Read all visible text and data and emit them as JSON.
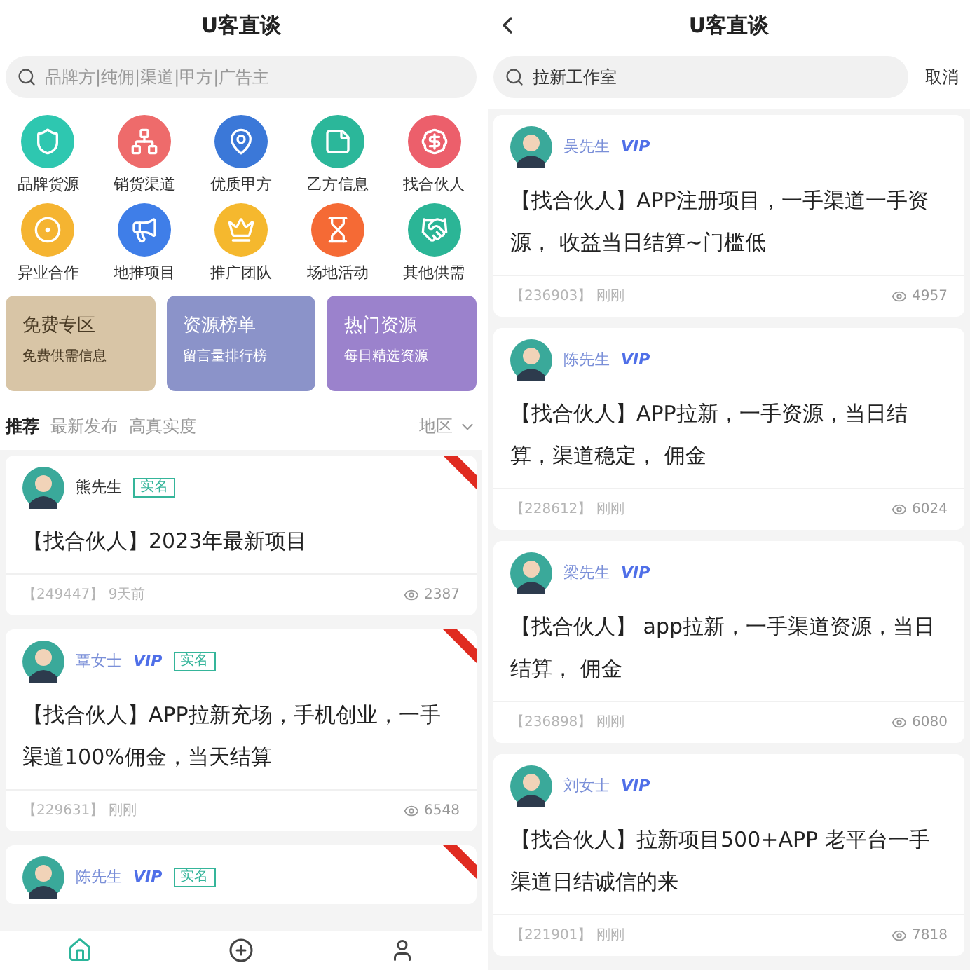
{
  "left": {
    "title": "U客直谈",
    "search": {
      "placeholder": "品牌方|纯佣|渠道|甲方|广告主"
    },
    "categories": [
      {
        "label": "品牌货源",
        "color": "#2ec7b0"
      },
      {
        "label": "销货渠道",
        "color": "#ee6b6b"
      },
      {
        "label": "优质甲方",
        "color": "#3b78d8"
      },
      {
        "label": "乙方信息",
        "color": "#2bb79a"
      },
      {
        "label": "找合伙人",
        "color": "#ec5f6b"
      },
      {
        "label": "异业合作",
        "color": "#f5b431"
      },
      {
        "label": "地推项目",
        "color": "#3f7ee8"
      },
      {
        "label": "推广团队",
        "color": "#f5b82e"
      },
      {
        "label": "场地活动",
        "color": "#f56a35"
      },
      {
        "label": "其他供需",
        "color": "#2bb596"
      }
    ],
    "banners": [
      {
        "title": "免费专区",
        "subtitle": "免费供需信息",
        "color": "#d8c5a6"
      },
      {
        "title": "资源榜单",
        "subtitle": "留言量排行榜",
        "color": "#8b93c9"
      },
      {
        "title": "热门资源",
        "subtitle": "每日精选资源",
        "color": "#9b82cc"
      }
    ],
    "filters": [
      {
        "label": "推荐",
        "selected": true
      },
      {
        "label": "最新发布",
        "selected": false
      },
      {
        "label": "高真实度",
        "selected": false
      }
    ],
    "region": "地区",
    "posts": [
      {
        "name": "熊先生",
        "verified": "实名",
        "pinned": true,
        "text": "【找合伙人】2023年最新项目",
        "id": "【249447】",
        "time": "9天前",
        "views": "2387"
      },
      {
        "name": "覃女士",
        "vip": "VIP",
        "verified": "实名",
        "pinned": true,
        "text": "【找合伙人】APP拉新充场，手机创业，一手渠道100%佣金，当天结算",
        "id": "【229631】",
        "time": "刚刚",
        "views": "6548"
      },
      {
        "name": "陈先生",
        "vip": "VIP",
        "verified": "实名",
        "pinned": true
      }
    ],
    "nav": [
      {
        "kind": "home",
        "selected": true
      },
      {
        "kind": "add",
        "selected": false
      },
      {
        "kind": "profile",
        "selected": false
      }
    ]
  },
  "right": {
    "title": "U客直谈",
    "search": {
      "value": "拉新工作室"
    },
    "cancel": "取消",
    "posts": [
      {
        "name": "吴先生",
        "vip": "VIP",
        "text": "【找合伙人】APP注册项目，一手渠道一手资源，  收益当日结算~门槛低",
        "id": "【236903】",
        "time": "刚刚",
        "views": "4957"
      },
      {
        "name": "陈先生",
        "vip": "VIP",
        "text": "【找合伙人】APP拉新，一手资源，当日结算，渠道稳定，  佣金",
        "id": "【228612】",
        "time": "刚刚",
        "views": "6024"
      },
      {
        "name": "梁先生",
        "vip": "VIP",
        "text": "【找合伙人】      app拉新，一手渠道资源，当日结算，  佣金",
        "id": "【236898】",
        "time": "刚刚",
        "views": "6080"
      },
      {
        "name": "刘女士",
        "vip": "VIP",
        "text": "【找合伙人】拉新项目500+APP 老平台一手渠道日结诚信的来",
        "id": "【221901】",
        "time": "刚刚",
        "views": "7818"
      }
    ]
  }
}
